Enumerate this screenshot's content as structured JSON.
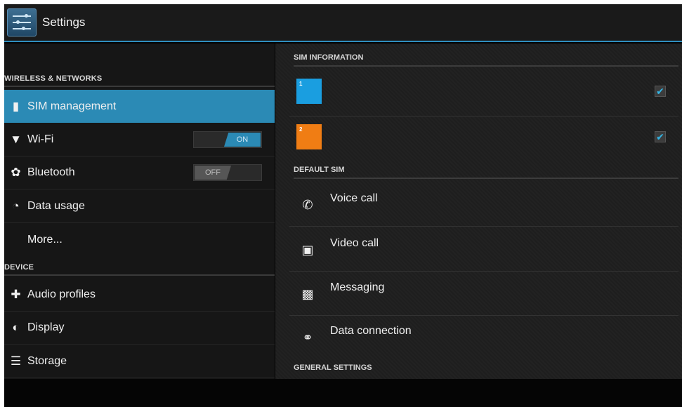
{
  "action_bar": {
    "title": "Settings",
    "icon": "settings-sliders-icon"
  },
  "left": {
    "sections": [
      {
        "header": "WIRELESS & NETWORKS"
      },
      {
        "header": "DEVICE"
      }
    ],
    "items": [
      {
        "label": "SIM management",
        "icon": "sim-card-icon",
        "selected": true
      },
      {
        "label": "Wi-Fi",
        "icon": "wifi-icon",
        "toggle": "ON"
      },
      {
        "label": "Bluetooth",
        "icon": "bluetooth-icon",
        "toggle": "OFF"
      },
      {
        "label": "Data usage",
        "icon": "data-usage-icon"
      },
      {
        "label": "More..."
      },
      {
        "label": "Audio profiles",
        "icon": "audio-profiles-icon"
      },
      {
        "label": "Display",
        "icon": "display-icon"
      },
      {
        "label": "Storage",
        "icon": "storage-icon"
      }
    ]
  },
  "right": {
    "sim_header": "SIM INFORMATION",
    "sims": [
      {
        "tag": "1",
        "color": "#1a9ee0",
        "checked": true
      },
      {
        "tag": "2",
        "color": "#f07d14",
        "checked": true
      }
    ],
    "default_header": "DEFAULT SIM",
    "options": [
      {
        "label": "Voice call",
        "icon": "phone-icon"
      },
      {
        "label": "Video call",
        "icon": "video-call-icon"
      },
      {
        "label": "Messaging",
        "icon": "messaging-icon"
      },
      {
        "label": "Data connection",
        "icon": "globe-icon"
      }
    ],
    "general_header": "GENERAL SETTINGS"
  },
  "colors": {
    "accent": "#2b8ab5",
    "sim1": "#1a9ee0",
    "sim2": "#f07d14"
  }
}
